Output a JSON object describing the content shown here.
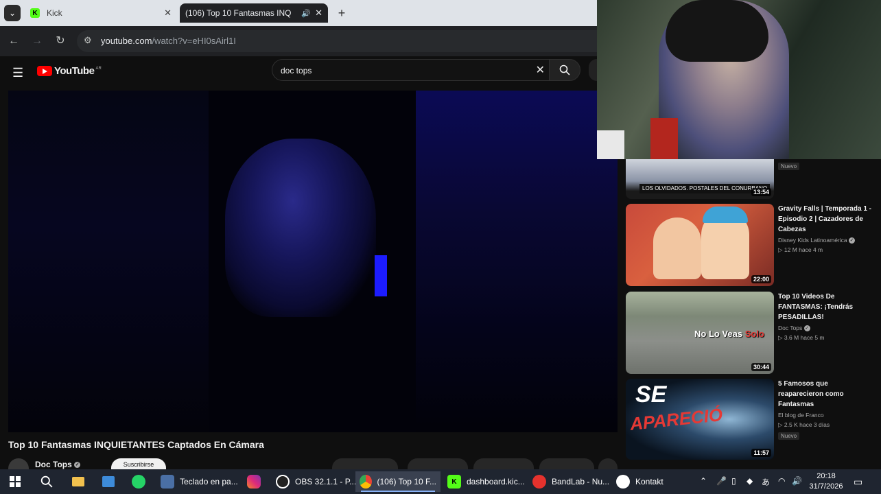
{
  "browser": {
    "tabs": [
      {
        "title": "Kick",
        "favicon": "kick-icon",
        "active": false
      },
      {
        "title": "(106) Top 10 Fantasmas INQ",
        "favicon": "youtube-icon",
        "active": true
      }
    ],
    "url": "youtube.com",
    "url_rest": "/watch?v=eHI0sAirl1I"
  },
  "youtube": {
    "logo_text": "YouTube",
    "country_code": "AR",
    "search_query": "doc tops",
    "video_title": "Top 10 Fantasmas INQUIETANTES Captados En Cámara",
    "channel_name": "Doc Tops",
    "subscribe_label": "Suscribirse"
  },
  "recommendations": [
    {
      "title": "",
      "channel": "",
      "meta": "",
      "duration": "13:54",
      "badge": "Nuevo",
      "thumb_text": "LOS OLVIDADOS. POSTALES DEL CONURBANO"
    },
    {
      "title": "Gravity Falls | Temporada 1 - Episodio 2 | Cazadores de Cabezas",
      "channel": "Disney Kids Latinoamérica",
      "meta": "12 M   hace 4 m",
      "duration": "22:00"
    },
    {
      "title": "Top 10 Videos De FANTASMAS: ¡Tendrás PESADILLAS!",
      "channel": "Doc Tops",
      "meta": "3.6 M   hace 5 m",
      "duration": "30:44",
      "thumb_text_a": "No Lo Veas",
      "thumb_text_b": "Solo"
    },
    {
      "title": "5 Famosos que reaparecieron como Fantasmas",
      "channel": "El blog de Franco",
      "meta": "2.5 K   hace 3 días",
      "duration": "11:57",
      "badge": "Nuevo",
      "thumb_text_a": "SE",
      "thumb_text_b": "APARECIÓ"
    }
  ],
  "taskbar": {
    "items": [
      {
        "label": "Teclado en pa...",
        "icon": "keyboard-app-icon"
      },
      {
        "label": "OBS 32.1.1 - P...",
        "icon": "obs-icon"
      },
      {
        "label": "(106) Top 10 F...",
        "icon": "chrome-icon",
        "active": true
      },
      {
        "label": "dashboard.kic...",
        "icon": "kick-icon"
      },
      {
        "label": "BandLab - Nu...",
        "icon": "bandlab-icon"
      },
      {
        "label": "Kontakt",
        "icon": "kontakt-icon"
      }
    ],
    "time": "20:18",
    "date": "31/7/2026"
  }
}
